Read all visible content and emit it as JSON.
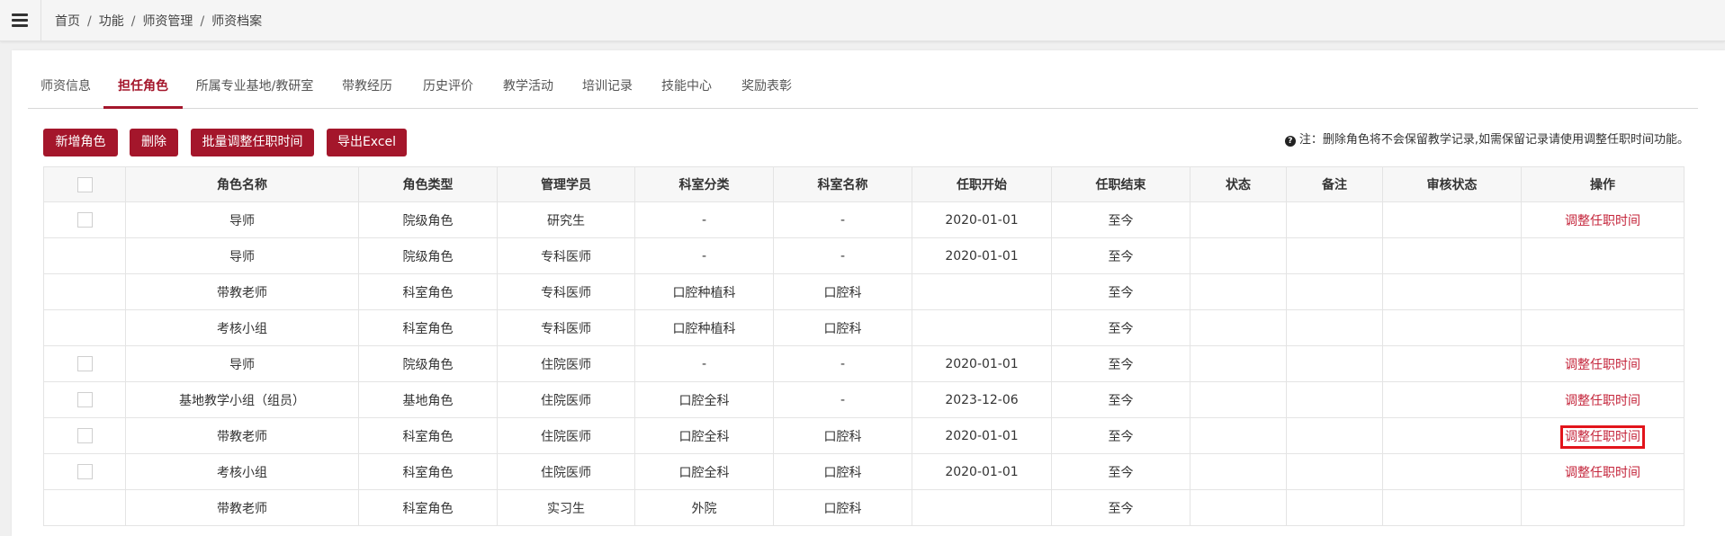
{
  "breadcrumb": [
    "首页",
    "功能",
    "师资管理",
    "师资档案"
  ],
  "tabs": [
    "师资信息",
    "担任角色",
    "所属专业基地/教研室",
    "带教经历",
    "历史评价",
    "教学活动",
    "培训记录",
    "技能中心",
    "奖励表彰"
  ],
  "active_tab_index": 1,
  "toolbar": {
    "add_label": "新增角色",
    "delete_label": "删除",
    "batch_label": "批量调整任职时间",
    "export_label": "导出Excel"
  },
  "note": "注：删除角色将不会保留教学记录,如需保留记录请使用调整任职时间功能。",
  "table": {
    "headers": [
      "角色名称",
      "角色类型",
      "管理学员",
      "科室分类",
      "科室名称",
      "任职开始",
      "任职结束",
      "状态",
      "备注",
      "审核状态",
      "操作"
    ],
    "rows": [
      {
        "checkbox": true,
        "cells": [
          "导师",
          "院级角色",
          "研究生",
          "-",
          "-",
          "2020-01-01",
          "至今",
          "",
          "",
          ""
        ],
        "action": "调整任职时间",
        "highlight": false
      },
      {
        "checkbox": false,
        "cells": [
          "导师",
          "院级角色",
          "专科医师",
          "-",
          "-",
          "2020-01-01",
          "至今",
          "",
          "",
          ""
        ],
        "action": "",
        "highlight": false
      },
      {
        "checkbox": false,
        "cells": [
          "带教老师",
          "科室角色",
          "专科医师",
          "口腔种植科",
          "口腔科",
          "",
          "至今",
          "",
          "",
          ""
        ],
        "action": "",
        "highlight": false
      },
      {
        "checkbox": false,
        "cells": [
          "考核小组",
          "科室角色",
          "专科医师",
          "口腔种植科",
          "口腔科",
          "",
          "至今",
          "",
          "",
          ""
        ],
        "action": "",
        "highlight": false
      },
      {
        "checkbox": true,
        "cells": [
          "导师",
          "院级角色",
          "住院医师",
          "-",
          "-",
          "2020-01-01",
          "至今",
          "",
          "",
          ""
        ],
        "action": "调整任职时间",
        "highlight": false
      },
      {
        "checkbox": true,
        "cells": [
          "基地教学小组（组员）",
          "基地角色",
          "住院医师",
          "口腔全科",
          "-",
          "2023-12-06",
          "至今",
          "",
          "",
          ""
        ],
        "action": "调整任职时间",
        "highlight": false
      },
      {
        "checkbox": true,
        "cells": [
          "带教老师",
          "科室角色",
          "住院医师",
          "口腔全科",
          "口腔科",
          "2020-01-01",
          "至今",
          "",
          "",
          ""
        ],
        "action": "调整任职时间",
        "highlight": true
      },
      {
        "checkbox": true,
        "cells": [
          "考核小组",
          "科室角色",
          "住院医师",
          "口腔全科",
          "口腔科",
          "2020-01-01",
          "至今",
          "",
          "",
          ""
        ],
        "action": "调整任职时间",
        "highlight": false
      },
      {
        "checkbox": false,
        "cells": [
          "带教老师",
          "科室角色",
          "实习生",
          "外院",
          "口腔科",
          "",
          "至今",
          "",
          "",
          ""
        ],
        "action": "",
        "highlight": false
      }
    ]
  },
  "colors": {
    "accent": "#a4162b",
    "link": "#c4243a",
    "highlight_box": "#e2141b"
  }
}
